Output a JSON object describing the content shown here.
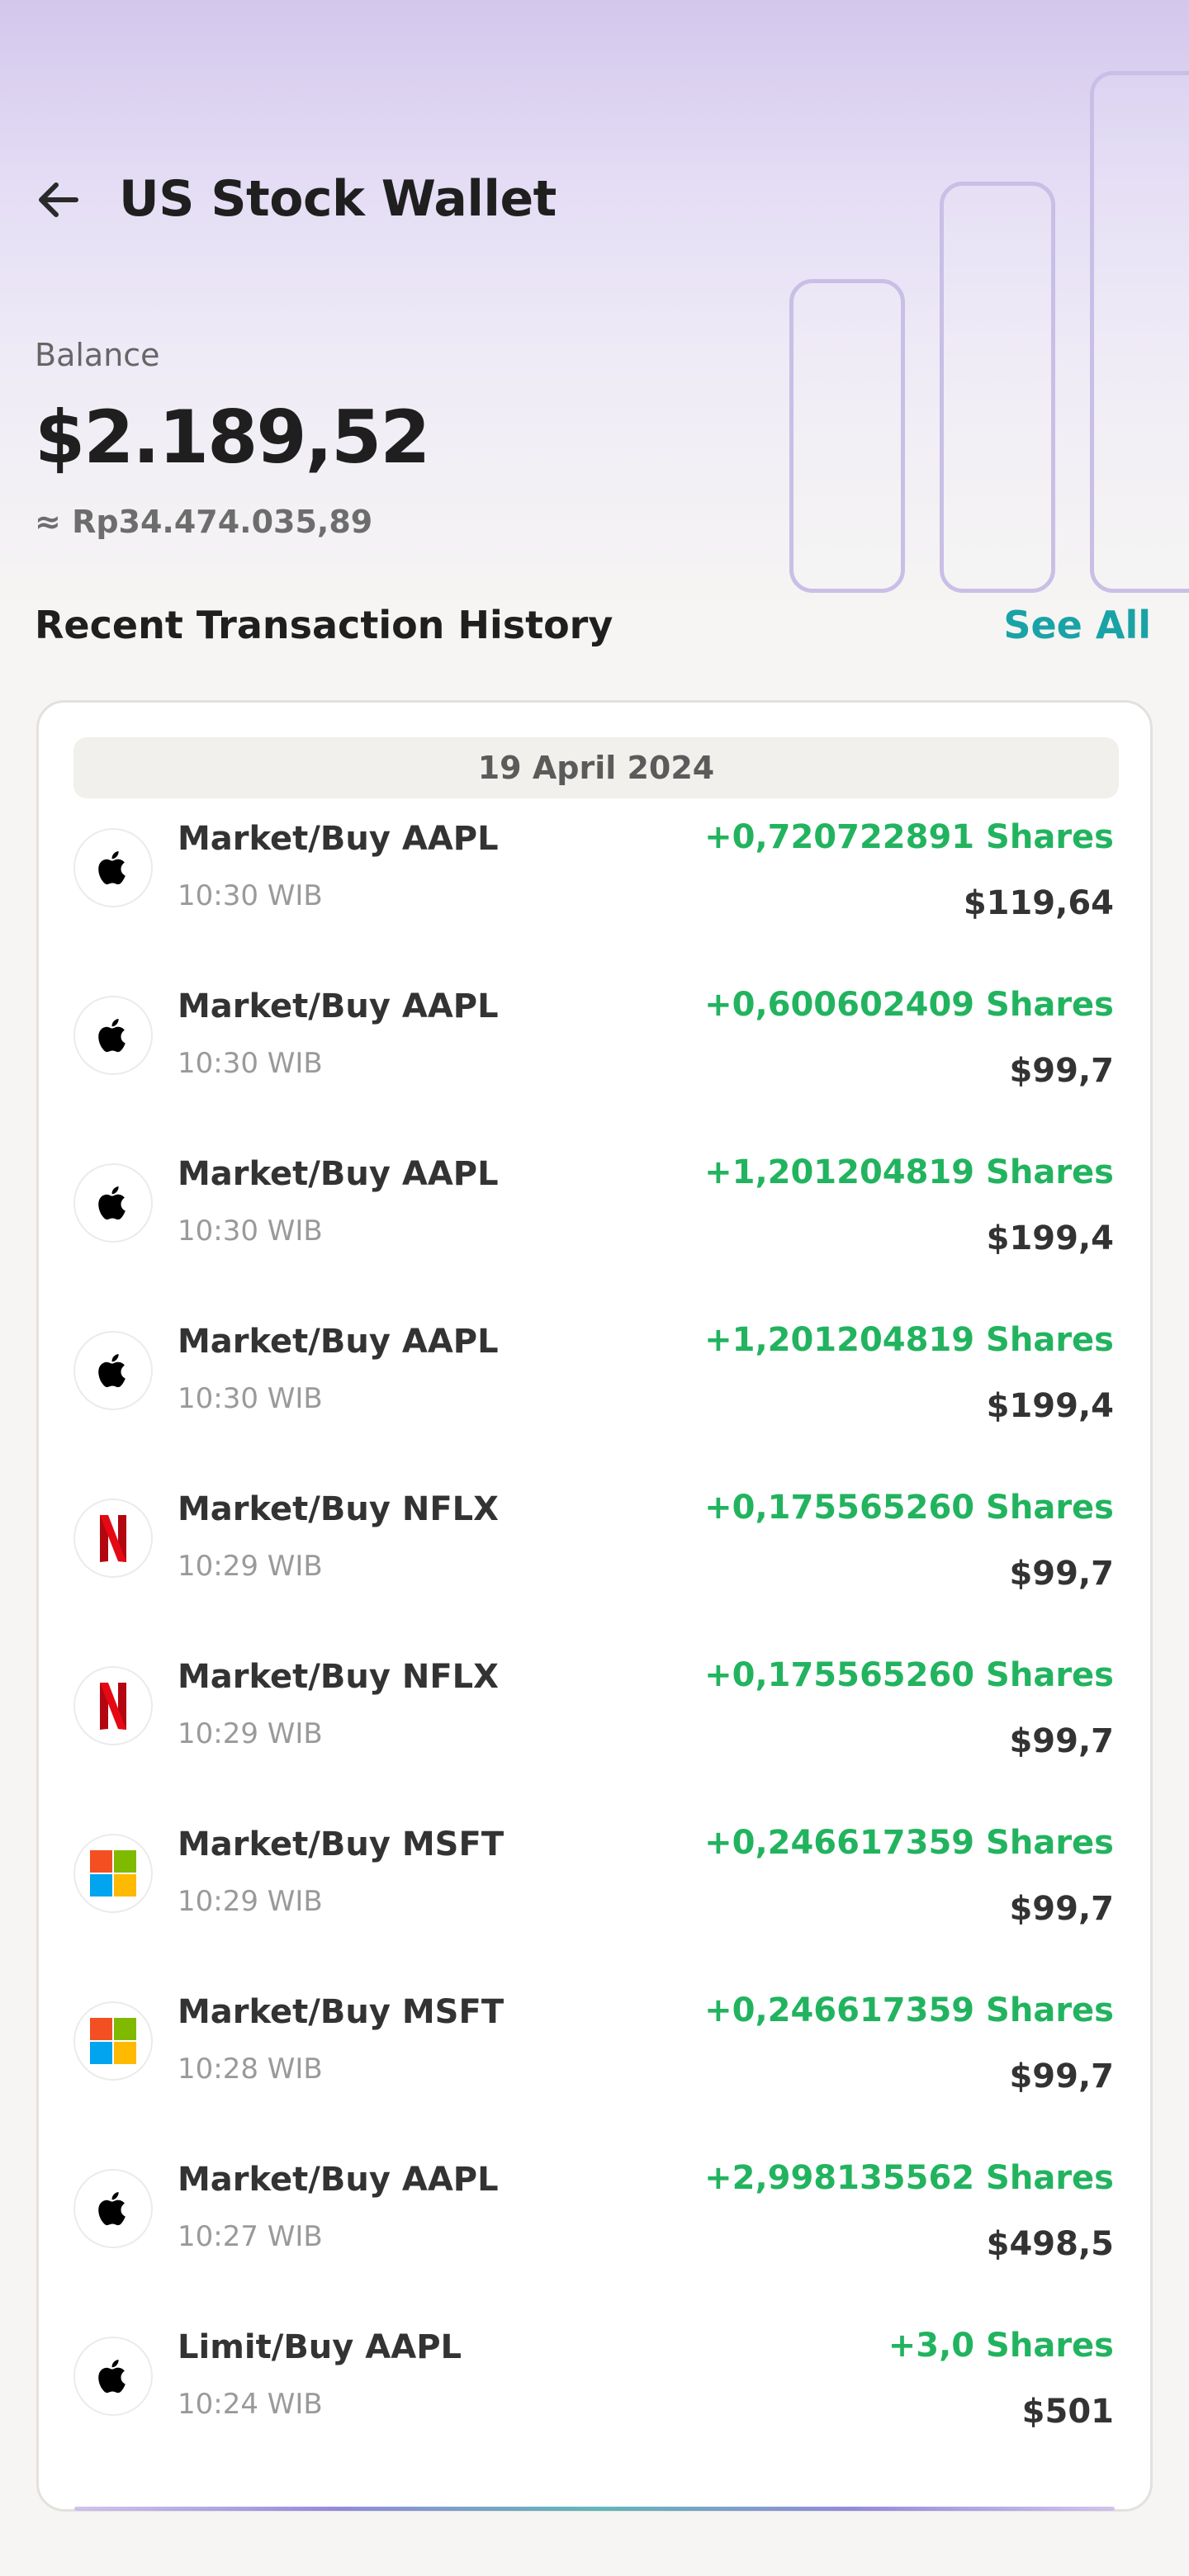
{
  "header": {
    "title": "US Stock Wallet"
  },
  "balance": {
    "label": "Balance",
    "value": "$2.189,52",
    "converted": "≈ Rp34.474.035,89"
  },
  "history": {
    "title": "Recent Transaction History",
    "see_all": "See All",
    "date": "19 April 2024",
    "items": [
      {
        "name": "Market/Buy AAPL",
        "time": "10:30 WIB",
        "shares": "+0,720722891 Shares",
        "amount": "$119,64",
        "logo": "apple-icon"
      },
      {
        "name": "Market/Buy AAPL",
        "time": "10:30 WIB",
        "shares": "+0,600602409 Shares",
        "amount": "$99,7",
        "logo": "apple-icon"
      },
      {
        "name": "Market/Buy AAPL",
        "time": "10:30 WIB",
        "shares": "+1,201204819 Shares",
        "amount": "$199,4",
        "logo": "apple-icon"
      },
      {
        "name": "Market/Buy AAPL",
        "time": "10:30 WIB",
        "shares": "+1,201204819 Shares",
        "amount": "$199,4",
        "logo": "apple-icon"
      },
      {
        "name": "Market/Buy NFLX",
        "time": "10:29 WIB",
        "shares": "+0,175565260 Shares",
        "amount": "$99,7",
        "logo": "netflix-icon"
      },
      {
        "name": "Market/Buy NFLX",
        "time": "10:29 WIB",
        "shares": "+0,175565260 Shares",
        "amount": "$99,7",
        "logo": "netflix-icon"
      },
      {
        "name": "Market/Buy MSFT",
        "time": "10:29 WIB",
        "shares": "+0,246617359 Shares",
        "amount": "$99,7",
        "logo": "microsoft-icon"
      },
      {
        "name": "Market/Buy MSFT",
        "time": "10:28 WIB",
        "shares": "+0,246617359 Shares",
        "amount": "$99,7",
        "logo": "microsoft-icon"
      },
      {
        "name": "Market/Buy AAPL",
        "time": "10:27 WIB",
        "shares": "+2,998135562 Shares",
        "amount": "$498,5",
        "logo": "apple-icon"
      },
      {
        "name": "Limit/Buy AAPL",
        "time": "10:24 WIB",
        "shares": "+3,0 Shares",
        "amount": "$501",
        "logo": "apple-icon"
      }
    ]
  },
  "colors": {
    "accent": "#1aa3a6",
    "positive": "#22b35f",
    "hero_purple": "#d3c7ec"
  }
}
